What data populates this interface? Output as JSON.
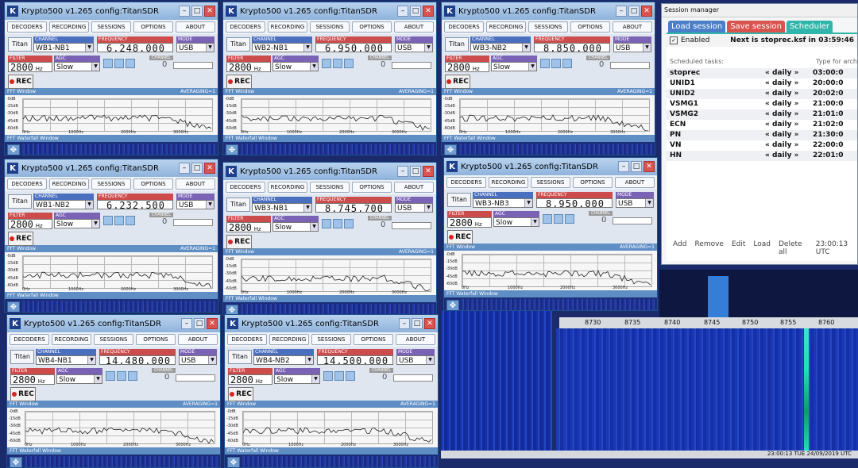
{
  "menu": [
    "DECODERS",
    "RECORDING",
    "SESSIONS",
    "OPTIONS",
    "ABOUT"
  ],
  "labels": {
    "titan": "Titan",
    "channel": "CHANNEL",
    "frequency": "FREQUENCY",
    "mode": "MODE",
    "filter": "FILTER",
    "agc": "AGC",
    "channel_small": "CHANNEL",
    "rec": "REC",
    "fft": "FFT Window",
    "averaging": "AVERAGING=1",
    "waterfall": "FFT Waterfall Window",
    "db": [
      "-0dB",
      "-15dB",
      "-30dB",
      "-45dB",
      "-60dB"
    ],
    "hz": [
      "0Hz",
      "1000Hz",
      "2000Hz",
      "3000Hz"
    ],
    "hz_unit": "Hz"
  },
  "windows": [
    {
      "title": "Krypto500 v1.265 config:TitanSDR",
      "channel": "WB1-NB1",
      "frequency": "6.248.000",
      "mode": "USB",
      "filter": "2800",
      "agc": "Slow",
      "chval": "0"
    },
    {
      "title": "Krypto500 v1.265 config:TitanSDR",
      "channel": "WB2-NB1",
      "frequency": "6.950.000",
      "mode": "USB",
      "filter": "2800",
      "agc": "Slow",
      "chval": "0"
    },
    {
      "title": "Krypto500 v1.265 config:TitanSDR",
      "channel": "WB3-NB2",
      "frequency": "8.850.000",
      "mode": "USB",
      "filter": "2800",
      "agc": "Slow",
      "chval": "0"
    },
    {
      "title": "Krypto500 v1.265 config:TitanSDR",
      "channel": "WB1-NB2",
      "frequency": "6.232.500",
      "mode": "USB",
      "filter": "2800",
      "agc": "Slow",
      "chval": "0"
    },
    {
      "title": "Krypto500 v1.265 config:TitanSDR",
      "channel": "WB3-NB1",
      "frequency": "8.745.700",
      "mode": "USB",
      "filter": "2800",
      "agc": "Slow",
      "chval": "0"
    },
    {
      "title": "Krypto500 v1.265 config:TitanSDR",
      "channel": "WB3-NB3",
      "frequency": "8.950.000",
      "mode": "USB",
      "filter": "2800",
      "agc": "Slow",
      "chval": "0"
    },
    {
      "title": "Krypto500 v1.265 config:TitanSDR",
      "channel": "WB4-NB1",
      "frequency": "14.480.000",
      "mode": "USB",
      "filter": "2800",
      "agc": "Slow",
      "chval": "0"
    },
    {
      "title": "Krypto500 v1.265 config:TitanSDR",
      "channel": "WB4-NB2",
      "frequency": "14.500.000",
      "mode": "USB",
      "filter": "2800",
      "agc": "Slow",
      "chval": "0"
    }
  ],
  "session_manager": {
    "title": "Session manager",
    "tabs": [
      "Load session",
      "Save session",
      "Scheduler"
    ],
    "enabled": "Enabled",
    "next": "Next is stoprec.ksf in 03:59:46",
    "scheduled_label": "Scheduled tasks:",
    "type_hint": "Type for arch",
    "tasks": [
      {
        "name": "stoprec",
        "period": "« daily »",
        "time": "03:00:0"
      },
      {
        "name": "UNID1",
        "period": "« daily »",
        "time": "20:00:0"
      },
      {
        "name": "UNID2",
        "period": "« daily »",
        "time": "20:02:0"
      },
      {
        "name": "VSMG1",
        "period": "« daily »",
        "time": "21:00:0"
      },
      {
        "name": "VSMG2",
        "period": "« daily »",
        "time": "21:01:0"
      },
      {
        "name": "ECN",
        "period": "« daily »",
        "time": "21:02:0"
      },
      {
        "name": "PN",
        "period": "« daily »",
        "time": "21:30:0"
      },
      {
        "name": "VN",
        "period": "« daily »",
        "time": "22:00:0"
      },
      {
        "name": "HN",
        "period": "« daily »",
        "time": "22:01:0"
      }
    ],
    "footer": [
      "Add",
      "Remove",
      "Edit",
      "Load",
      "Delete all"
    ],
    "clock": "23:00:13 UTC"
  },
  "spectrum": {
    "ticks": [
      "8730",
      "8735",
      "8740",
      "8745",
      "8750",
      "8755",
      "8760"
    ]
  },
  "status": {
    "datetime": "23:00:13 TUE 24/09/2019 UTC"
  }
}
